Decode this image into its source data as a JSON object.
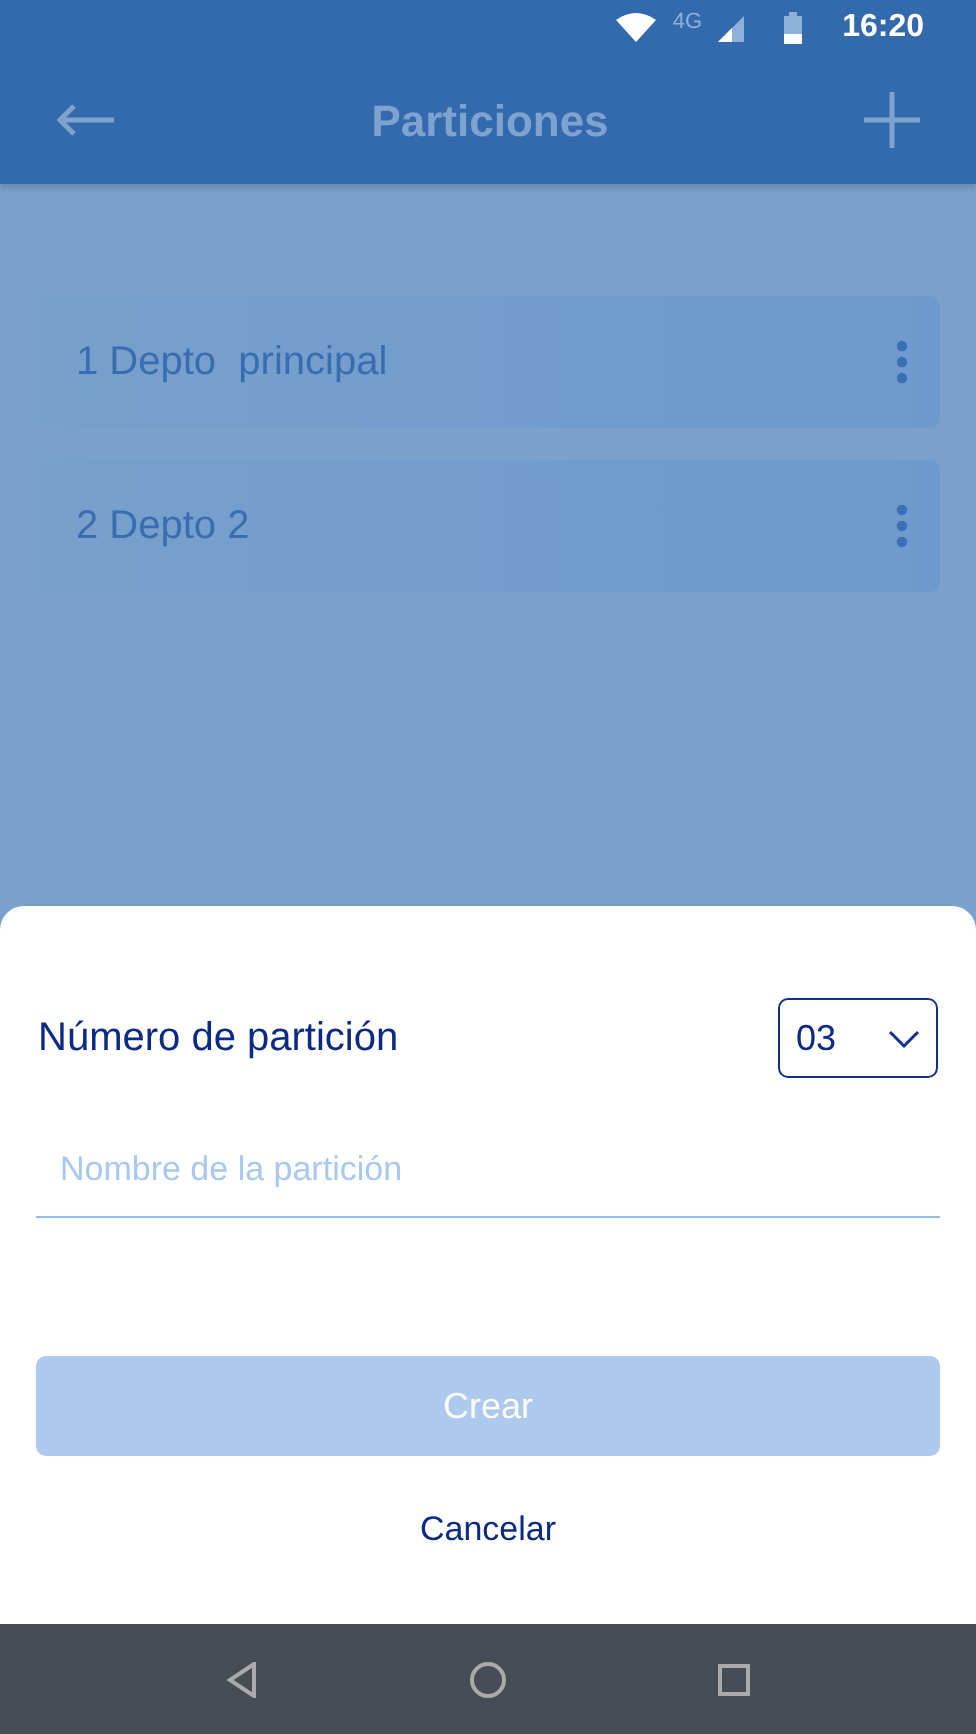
{
  "status_bar": {
    "network": "4G",
    "time": "16:20"
  },
  "app_bar": {
    "title": "Particiones"
  },
  "partitions": [
    {
      "label": "1 Depto  principal"
    },
    {
      "label": "2 Depto 2"
    }
  ],
  "sheet": {
    "number_label": "Número de partición",
    "number_select": {
      "value": "03"
    },
    "name_field": {
      "placeholder": "Nombre de la partición"
    },
    "create_button": {
      "label": "Crear",
      "disabled": true
    },
    "cancel_button": {
      "label": "Cancelar"
    }
  }
}
